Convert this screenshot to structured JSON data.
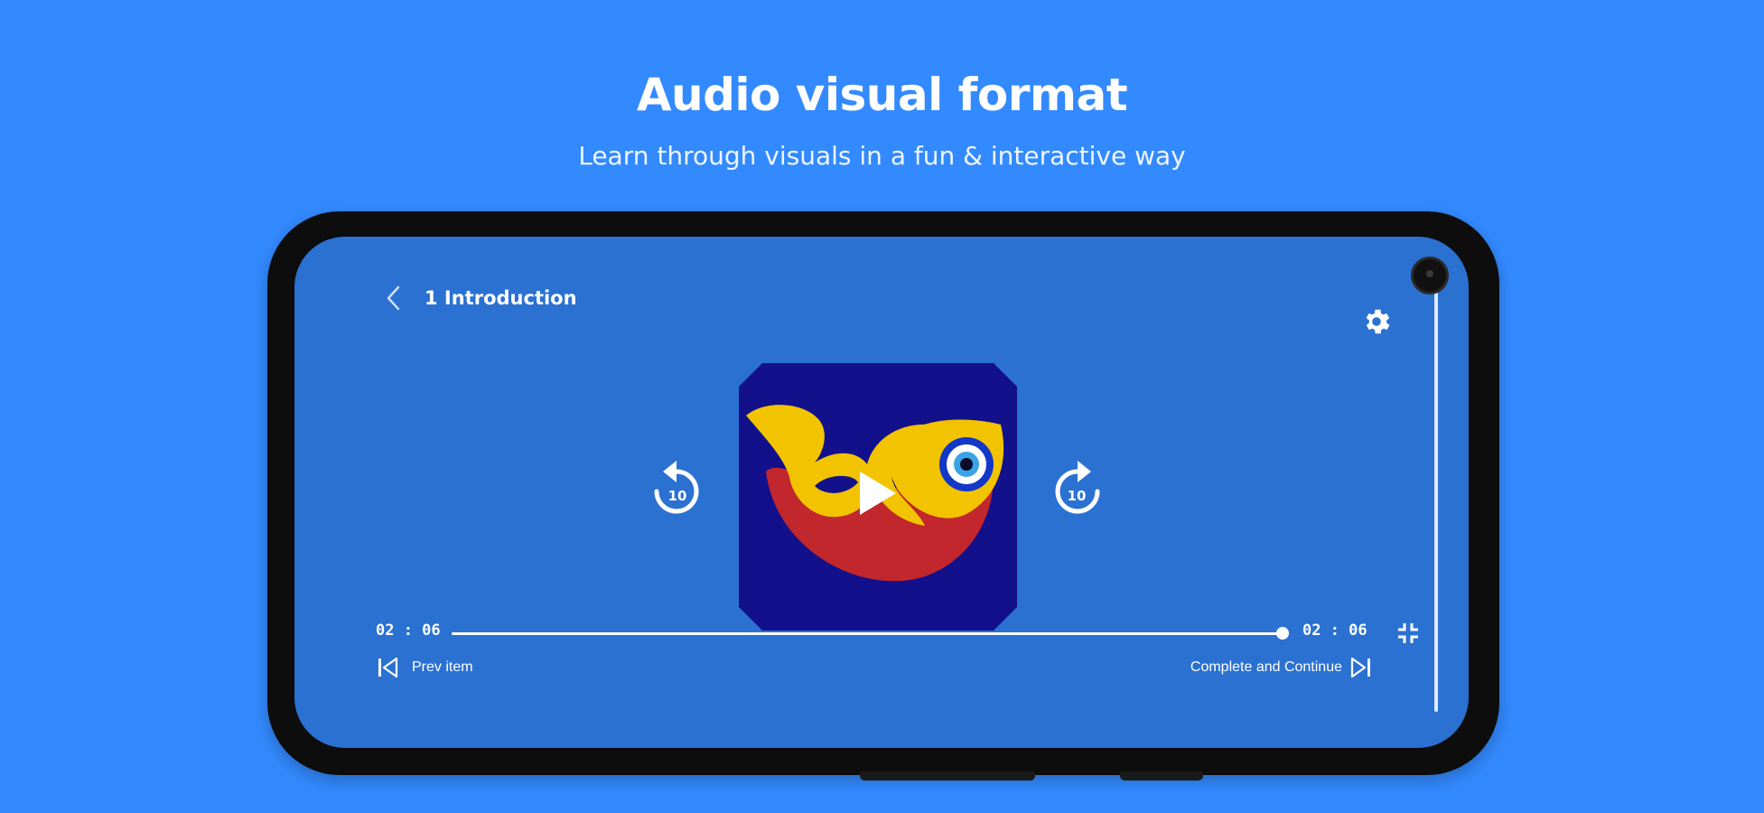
{
  "promo": {
    "headline": "Audio visual format",
    "subhead": "Learn through visuals in a fun & interactive way"
  },
  "player": {
    "title": "1 Introduction",
    "elapsed": "02 : 06",
    "duration": "02 : 06",
    "progress_fraction": 1.0,
    "skip_back_seconds": "10",
    "skip_forward_seconds": "10",
    "prev_label": "Prev item",
    "next_label": "Complete and Continue"
  },
  "icons": {
    "back": "chevron-left-icon",
    "settings": "gear-icon",
    "play": "play-icon",
    "rewind": "replay-10-icon",
    "forward": "forward-10-icon",
    "fullscreen": "fullscreen-exit-icon",
    "prev": "skip-previous-icon",
    "next": "skip-next-icon"
  },
  "colors": {
    "page_bg": "#338aff",
    "screen_bg": "#2a71d2",
    "thumb_bg": "#12108a",
    "fish_body": "#c1272d",
    "fish_fin": "#f2c300"
  }
}
